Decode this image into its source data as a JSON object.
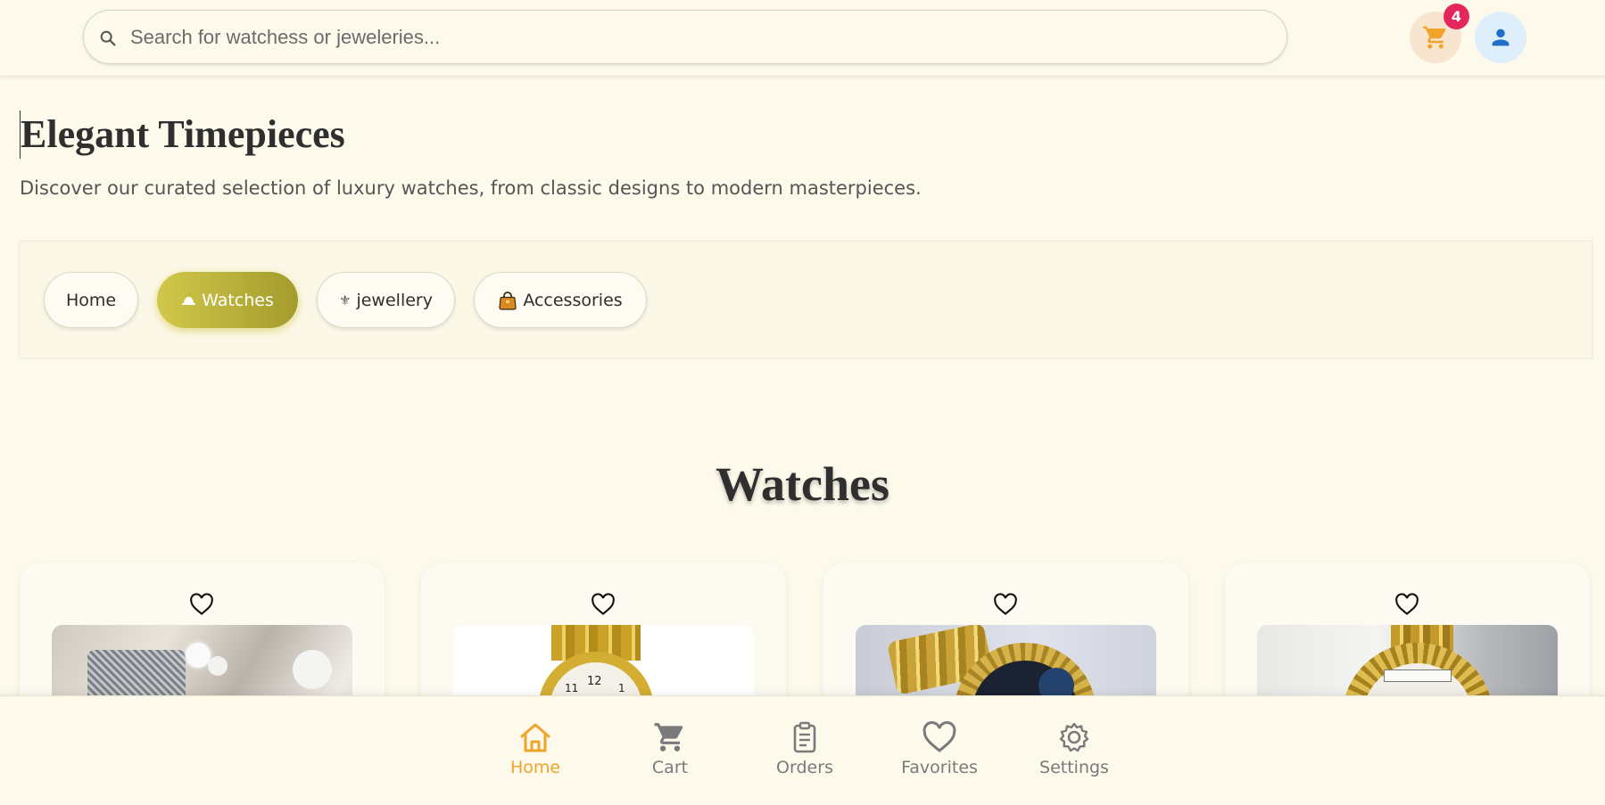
{
  "header": {
    "search_placeholder": "Search for watchess or jeweleries...",
    "cart_count": "4",
    "colors": {
      "cart_icon": "#f0a42a",
      "badge": "#e3265c",
      "user_icon": "#1f6fc9"
    }
  },
  "hero": {
    "title": "Elegant Timepieces",
    "subtitle": "Discover our curated selection of luxury watches, from classic designs to modern masterpieces."
  },
  "categories": [
    {
      "label": "Home",
      "icon": ""
    },
    {
      "label": "Watches",
      "icon": "hat-icon",
      "active": true
    },
    {
      "label": "jewellery",
      "icon": "fleur-de-lis-icon"
    },
    {
      "label": "Accessories",
      "icon": "handbag-icon"
    }
  ],
  "section": {
    "title": "Watches"
  },
  "products": [
    {
      "image": "silver-mesh-watch-with-flowers"
    },
    {
      "image": "gold-watch-white-dial"
    },
    {
      "image": "gold-watch-black-dial"
    },
    {
      "image": "gold-datejust-watch-on-glove"
    }
  ],
  "bottom_nav": [
    {
      "label": "Home",
      "icon": "home-icon",
      "active": true
    },
    {
      "label": "Cart",
      "icon": "cart-icon"
    },
    {
      "label": "Orders",
      "icon": "clipboard-icon"
    },
    {
      "label": "Favorites",
      "icon": "heart-icon"
    },
    {
      "label": "Settings",
      "icon": "gear-icon"
    }
  ],
  "accent_color": "#f0a42a",
  "active_pill_gradient": [
    "#d1c84a",
    "#a39b2c"
  ]
}
